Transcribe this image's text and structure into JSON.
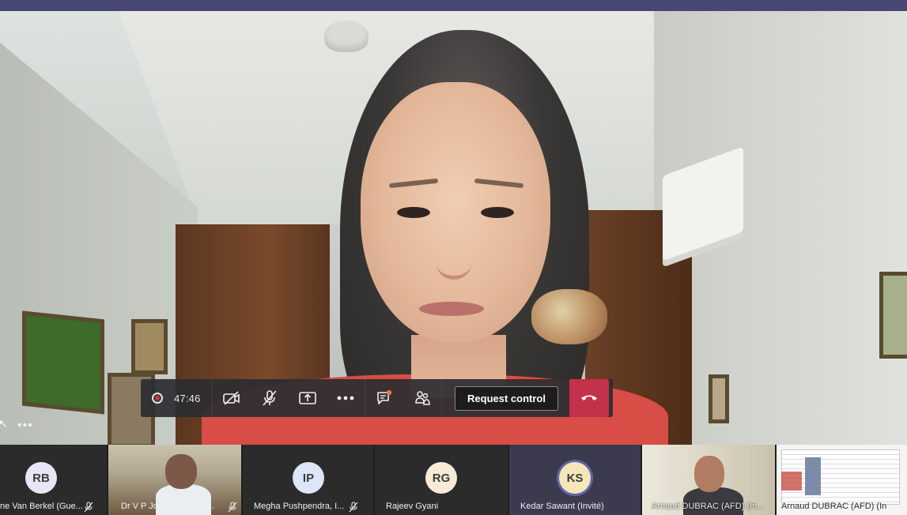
{
  "meeting": {
    "timer": "47:46",
    "request_control_label": "Request control",
    "more_options_glyph": "•••",
    "left_more_glyph": "•••"
  },
  "controls": [
    {
      "id": "recording",
      "icon": "record-icon"
    },
    {
      "id": "camera",
      "icon": "camera-off-icon",
      "state": "off"
    },
    {
      "id": "mic",
      "icon": "mic-off-icon",
      "state": "muted"
    },
    {
      "id": "share",
      "icon": "share-screen-icon"
    },
    {
      "id": "more",
      "icon": "more-options-icon"
    },
    {
      "id": "chat",
      "icon": "chat-icon",
      "badge": true
    },
    {
      "id": "participants",
      "icon": "participants-icon"
    },
    {
      "id": "hangup",
      "icon": "hang-up-icon",
      "color": "#c4314b"
    }
  ],
  "participants": [
    {
      "initials": "RB",
      "name": "ne Van Berkel (Gue...",
      "muted": true,
      "avatar_color": "#e8e6f5"
    },
    {
      "initials": "",
      "name": "Dr V P Joy, Secy (Coo...",
      "muted": true,
      "video": true
    },
    {
      "initials": "IP",
      "name": "Megha Pushpendra, I...",
      "muted": true,
      "avatar_color": "#dde6f7"
    },
    {
      "initials": "RG",
      "name": "Rajeev Gyani",
      "muted": false,
      "avatar_color": "#f7ead7"
    },
    {
      "initials": "KS",
      "name": "Kedar Sawant (Invité)",
      "muted": false,
      "avatar_color": "#f6e7b9",
      "speaking": true
    },
    {
      "initials": "",
      "name": "Arnaud DUBRAC (AFD) (In...",
      "muted": true,
      "video": true
    },
    {
      "initials": "",
      "name": "Arnaud DUBRAC (AFD) (In",
      "muted": false,
      "video": true,
      "screen_share": true
    }
  ],
  "colors": {
    "top_bar": "#464775",
    "hangup": "#c4314b",
    "speaking_ring": "#6264a7"
  }
}
